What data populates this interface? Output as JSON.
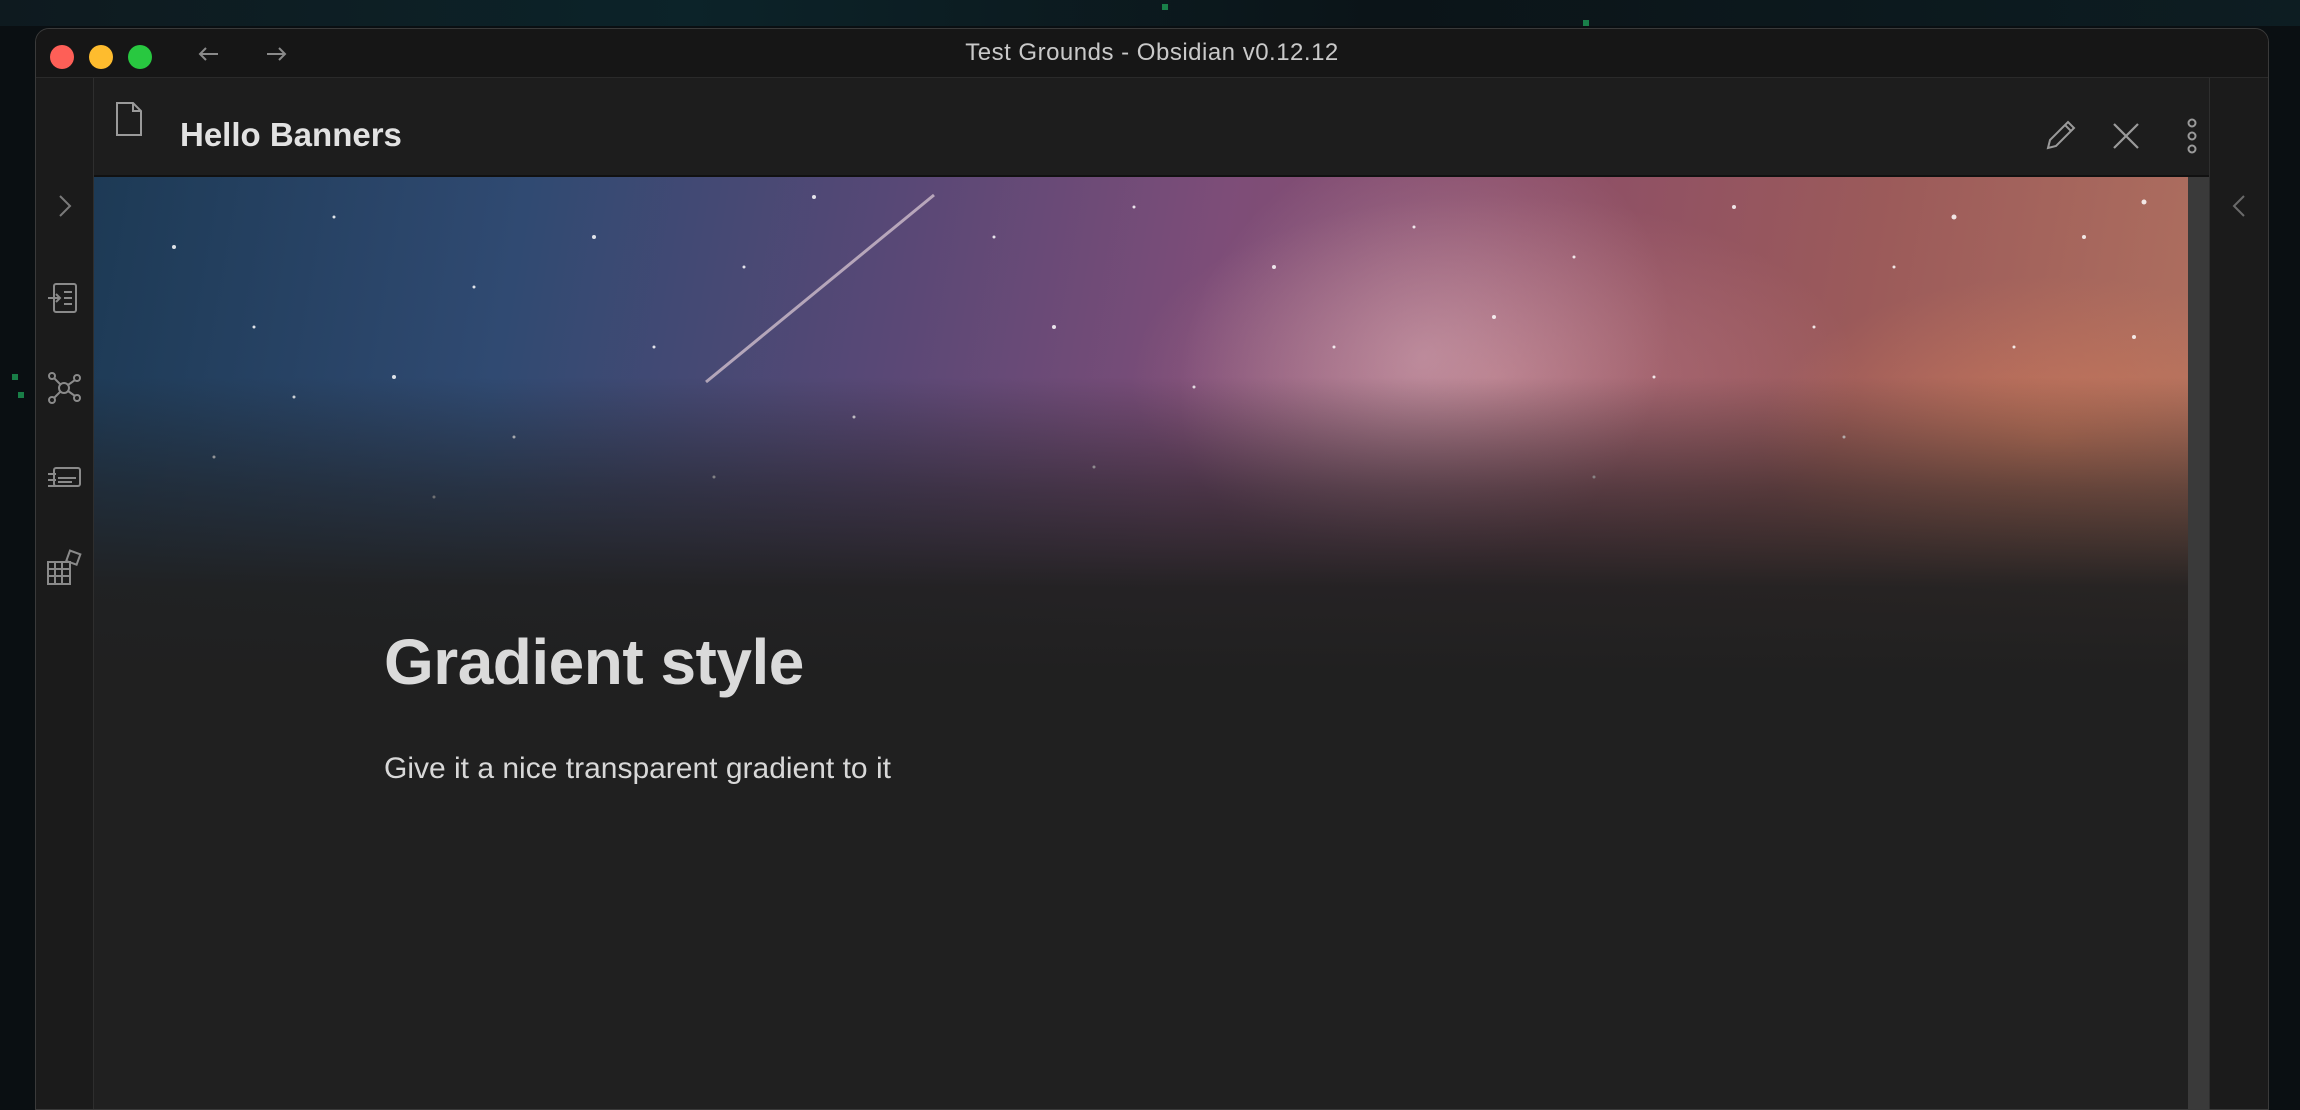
{
  "window": {
    "title": "Test Grounds - Obsidian v0.12.12"
  },
  "ribbon": {
    "icons": [
      "expand-sidebar-icon",
      "switcher-icon",
      "graph-view-icon",
      "slides-icon",
      "plugins-icon"
    ]
  },
  "right_sidebar": {
    "icon": "collapse-right-sidebar-icon"
  },
  "view_header": {
    "title": "Hello Banners",
    "actions": [
      "edit-icon",
      "close-icon",
      "more-options-icon"
    ]
  },
  "note": {
    "heading": "Gradient style",
    "paragraph": "Give it a nice transparent gradient to it"
  },
  "colors": {
    "background": "#202020",
    "text": "#dadada",
    "traffic_red": "#fe5f57",
    "traffic_yellow": "#febc2e",
    "traffic_green": "#28c840"
  }
}
